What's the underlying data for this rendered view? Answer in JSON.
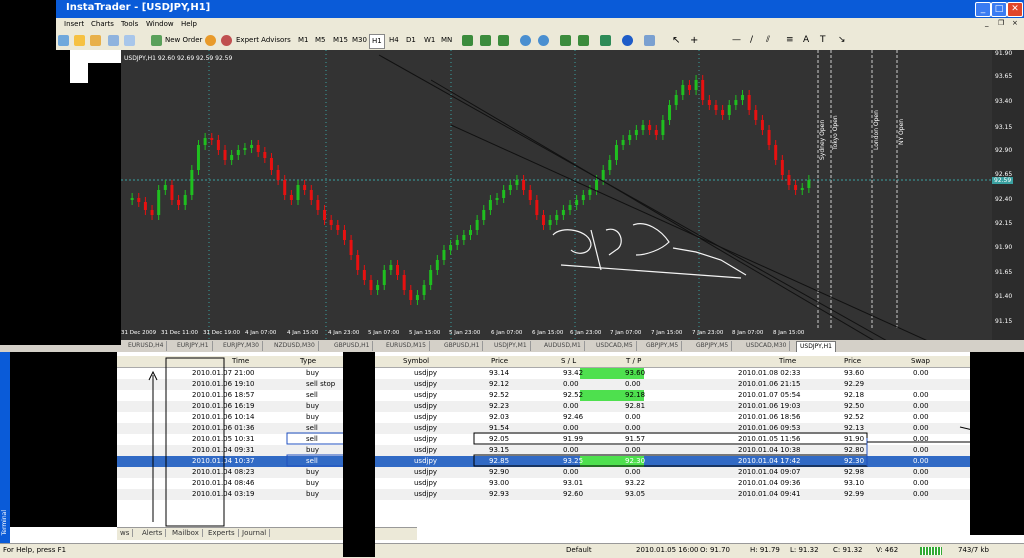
{
  "window": {
    "title": "InstaTrader - [USDJPY,H1]",
    "min": "_",
    "max": "□",
    "close": "✕",
    "inner_min": "_",
    "inner_restore": "❐",
    "inner_close": "×"
  },
  "menu": [
    "Insert",
    "Charts",
    "Tools",
    "Window",
    "Help"
  ],
  "toolbar": {
    "new_order": "New Order",
    "expert_advisors": "Expert Advisors",
    "timeframes": [
      "M1",
      "M5",
      "M15",
      "M30",
      "H1",
      "H4",
      "D1",
      "W1",
      "MN"
    ]
  },
  "nav": {
    "snippet": "abu"
  },
  "chart": {
    "header": "USDJPY,H1  92.60 92.69 92.59 92.59",
    "current_price": "92.59",
    "session_labels": [
      "Sydney Open",
      "Tokyo Open",
      "London Open",
      "NY Open"
    ],
    "y_ticks": [
      "91.90",
      "93.65",
      "93.40",
      "93.15",
      "92.90",
      "92.65",
      "92.40",
      "92.15",
      "91.90",
      "91.65",
      "91.40",
      "91.15"
    ],
    "x_ticks": [
      "31 Dec 2009",
      "31 Dec 11:00",
      "31 Dec 19:00",
      "4 Jan 07:00",
      "4 Jan 15:00",
      "4 Jan 23:00",
      "5 Jan 07:00",
      "5 Jan 15:00",
      "5 Jan 23:00",
      "6 Jan 07:00",
      "6 Jan 15:00",
      "6 Jan 23:00",
      "7 Jan 07:00",
      "7 Jan 15:00",
      "7 Jan 23:00",
      "8 Jan 07:00",
      "8 Jan 15:00"
    ]
  },
  "chart_tabs": [
    "EURUSD,H4",
    "EURJPY,H1",
    "EURJPY,M30",
    "NZDUSD,M30",
    "GBPUSD,H1",
    "EURUSD,M15",
    "GBPUSD,H1",
    "USDJPY,M1",
    "AUDUSD,M1",
    "USDCAD,M5",
    "GBPJPY,M5",
    "GBPJPY,M5",
    "USDCAD,M30",
    "USDJPY,H1"
  ],
  "table": {
    "headers": [
      "Time",
      "Type",
      "Symbol",
      "Price",
      "S / L",
      "T / P",
      "Time",
      "Price",
      "Swap"
    ],
    "rows": [
      [
        "2010.01.07 21:00",
        "buy",
        "usdjpy",
        "93.14",
        "93.42",
        "93.60",
        "2010.01.08 02:33",
        "93.60",
        "0.00"
      ],
      [
        "2010.01.06 19:10",
        "sell stop",
        "usdjpy",
        "92.12",
        "0.00",
        "0.00",
        "2010.01.06 21:15",
        "92.29",
        ""
      ],
      [
        "2010.01.06 18:57",
        "sell",
        "usdjpy",
        "92.52",
        "92.52",
        "92.18",
        "2010.01.07 05:54",
        "92.18",
        "0.00"
      ],
      [
        "2010.01.06 16:19",
        "buy",
        "usdjpy",
        "92.23",
        "0.00",
        "92.81",
        "2010.01.06 19:03",
        "92.50",
        "0.00"
      ],
      [
        "2010.01.06 10:14",
        "buy",
        "usdjpy",
        "92.03",
        "92.46",
        "0.00",
        "2010.01.06 18:56",
        "92.52",
        "0.00"
      ],
      [
        "2010.01.06 01:36",
        "sell",
        "usdjpy",
        "91.54",
        "0.00",
        "0.00",
        "2010.01.06 09:53",
        "92.13",
        "0.00"
      ],
      [
        "2010.01.05 10:31",
        "sell",
        "usdjpy",
        "92.05",
        "91.99",
        "91.57",
        "2010.01.05 11:56",
        "91.90",
        "0.00"
      ],
      [
        "2010.01.04 09:31",
        "buy",
        "usdjpy",
        "93.15",
        "0.00",
        "0.00",
        "2010.01.04 10:38",
        "92.80",
        "0.00"
      ],
      [
        "2010.01.04 10:37",
        "sell",
        "usdjpy",
        "92.85",
        "93.25",
        "92.30",
        "2010.01.04 17:42",
        "92.30",
        "0.00"
      ],
      [
        "2010.01.04 08:23",
        "buy",
        "usdjpy",
        "92.90",
        "0.00",
        "0.00",
        "2010.01.04 09:07",
        "92.98",
        "0.00"
      ],
      [
        "2010.01.04 08:46",
        "buy",
        "usdjpy",
        "93.00",
        "93.01",
        "93.22",
        "2010.01.04 09:36",
        "93.10",
        "0.00"
      ],
      [
        "2010.01.04 03:19",
        "buy",
        "usdjpy",
        "92.93",
        "92.60",
        "93.05",
        "2010.01.04 09:41",
        "92.99",
        "0.00"
      ]
    ],
    "green_tp_rows": [
      0,
      2,
      8
    ]
  },
  "terminal": {
    "side_label": "Terminal",
    "tabs": [
      "ws",
      "Alerts",
      "Mailbox",
      "Experts",
      "Journal"
    ]
  },
  "status": {
    "help": "For Help, press F1",
    "profile": "Default",
    "datetime": "2010.01.05 16:00",
    "open": "O: 91.70",
    "high": "H: 91.79",
    "low": "L: 91.32",
    "close": "C: 91.32",
    "volume": "V: 462",
    "traffic": "743/7 kb"
  }
}
